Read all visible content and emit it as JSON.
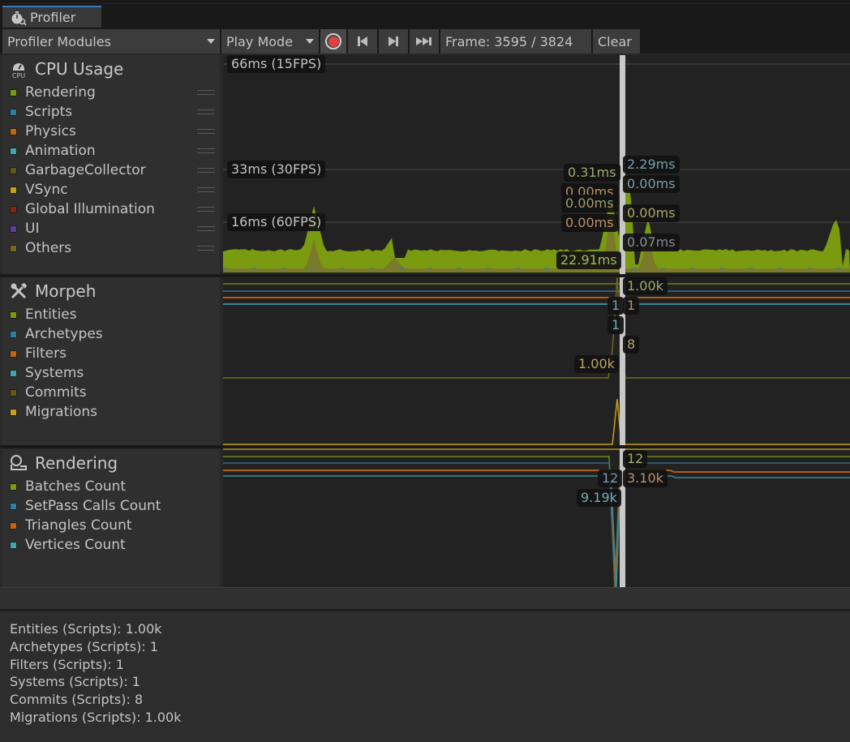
{
  "window": {
    "tab_title": "Profiler",
    "tab_icon": "stopwatch-icon"
  },
  "toolbar": {
    "modules_dropdown": "Profiler Modules",
    "mode_dropdown": "Play Mode",
    "record_icon": "record-icon",
    "prev_frame_icon": "step-back-icon",
    "next_frame_icon": "step-forward-icon",
    "last_frame_icon": "fast-forward-icon",
    "frame_label": "Frame: 3595 / 3824",
    "clear_label": "Clear"
  },
  "modules": [
    {
      "title": "CPU Usage",
      "icon": "cpu-icon",
      "legend": [
        {
          "label": "Rendering",
          "color": "#7a9a10"
        },
        {
          "label": "Scripts",
          "color": "#2b7ea8"
        },
        {
          "label": "Physics",
          "color": "#c4640e"
        },
        {
          "label": "Animation",
          "color": "#3aa8b8"
        },
        {
          "label": "GarbageCollector",
          "color": "#5e5a14"
        },
        {
          "label": "VSync",
          "color": "#c8a010"
        },
        {
          "label": "Global Illumination",
          "color": "#8a2410"
        },
        {
          "label": "UI",
          "color": "#5c3ea0"
        },
        {
          "label": "Others",
          "color": "#6e6e1a"
        }
      ]
    },
    {
      "title": "Morpeh",
      "icon": "tools-icon",
      "legend": [
        {
          "label": "Entities",
          "color": "#7a9a10"
        },
        {
          "label": "Archetypes",
          "color": "#2b7ea8"
        },
        {
          "label": "Filters",
          "color": "#c4640e"
        },
        {
          "label": "Systems",
          "color": "#3aa8b8"
        },
        {
          "label": "Commits",
          "color": "#5e5a14"
        },
        {
          "label": "Migrations",
          "color": "#c8a010"
        }
      ]
    },
    {
      "title": "Rendering",
      "icon": "rendering-icon",
      "legend": [
        {
          "label": "Batches Count",
          "color": "#7a9a10"
        },
        {
          "label": "SetPass Calls Count",
          "color": "#2b7ea8"
        },
        {
          "label": "Triangles Count",
          "color": "#c4640e"
        },
        {
          "label": "Vertices Count",
          "color": "#3aa8b8"
        }
      ]
    }
  ],
  "chart_data": [
    {
      "type": "area",
      "title": "CPU Usage",
      "gridlines": [
        {
          "label": "66ms (15FPS)",
          "value_ms": 66
        },
        {
          "label": "33ms (30FPS)",
          "value_ms": 33
        },
        {
          "label": "16ms (60FPS)",
          "value_ms": 16
        }
      ],
      "selected_frame": 3595,
      "total_frames": 3824,
      "selected_values": [
        {
          "label": "22.91ms",
          "series": "Rendering",
          "color": "#a8b870"
        },
        {
          "label": "0.31ms",
          "series": "Scripts",
          "color": "#a8b870"
        },
        {
          "label": "0.00ms",
          "series": "Physics",
          "color": "#c89870"
        },
        {
          "label": "0.00ms",
          "series": "Animation",
          "color": "#a8a870"
        },
        {
          "label": "0.00ms",
          "series": "GarbageCollector",
          "color": "#c89870"
        },
        {
          "label": "2.29ms",
          "series": "VSync",
          "color": "#80a8b8"
        },
        {
          "label": "0.00ms",
          "series": "Global Illumination",
          "color": "#80a8b8"
        },
        {
          "label": "0.00ms",
          "series": "UI",
          "color": "#b8b070"
        },
        {
          "label": "0.07ms",
          "series": "Others",
          "color": "#9090a8"
        }
      ],
      "ylim_ms": [
        0,
        70
      ]
    },
    {
      "type": "line",
      "title": "Morpeh",
      "selected_values": [
        {
          "label": "1.00k",
          "series": "Entities",
          "color": "#a8b870"
        },
        {
          "label": "1",
          "series": "Archetypes",
          "color": "#80a8b8"
        },
        {
          "label": "1",
          "series": "Filters",
          "color": "#c89870"
        },
        {
          "label": "1",
          "series": "Systems",
          "color": "#80b8c0"
        },
        {
          "label": "8",
          "series": "Commits",
          "color": "#b8b070"
        },
        {
          "label": "1.00k",
          "series": "Migrations",
          "color": "#c8b070"
        }
      ]
    },
    {
      "type": "line",
      "title": "Rendering",
      "selected_values": [
        {
          "label": "12",
          "series": "Batches Count",
          "color": "#a8b870"
        },
        {
          "label": "12",
          "series": "SetPass Calls Count",
          "color": "#80a8b8"
        },
        {
          "label": "3.10k",
          "series": "Triangles Count",
          "color": "#c89870"
        },
        {
          "label": "9.19k",
          "series": "Vertices Count",
          "color": "#80b8c0"
        }
      ]
    }
  ],
  "details": [
    "Entities (Scripts): 1.00k",
    "Archetypes (Scripts): 1",
    "Filters (Scripts): 1",
    "Systems (Scripts): 1",
    "Commits (Scripts): 8",
    "Migrations (Scripts): 1.00k"
  ]
}
